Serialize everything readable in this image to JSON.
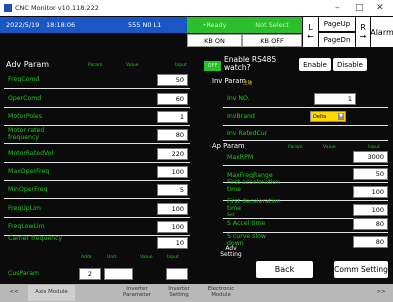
{
  "window": {
    "title": "CNC Monitor v10.118.222",
    "min": "–",
    "max": "□",
    "close": "✕"
  },
  "status": {
    "date": "2022/5/19",
    "time": "18:18:06",
    "machine": "555 N0 L1",
    "ready": "•Ready",
    "not_select": "Not Select",
    "kb_on": "KB ON",
    "kb_off": "KB OFF"
  },
  "nav": {
    "left_letter": "L",
    "left_arrow": "←",
    "page_up": "PageUp",
    "page_dn": "PageDn",
    "right_letter": "R",
    "right_arrow": "→",
    "alarm": "Alarm"
  },
  "adv": {
    "heading": "Adv Param",
    "col_param": "Param",
    "col_value": "Value",
    "col_input": "Input",
    "rows": [
      {
        "label": "FreqComd",
        "input": "50"
      },
      {
        "label": "OperComd",
        "input": "60"
      },
      {
        "label": "MotorPoles",
        "input": "1"
      },
      {
        "label": "Motor rated frequency",
        "input": "80"
      },
      {
        "label": "MotorRatedVol",
        "input": "220"
      },
      {
        "label": "MaxOperFreq",
        "input": "100"
      },
      {
        "label": "MinOperFreq",
        "input": "5"
      },
      {
        "label": "FreqUpLim",
        "input": "100"
      },
      {
        "label": "FreqLowLim",
        "input": "100"
      },
      {
        "label": "Carrier frequency",
        "input": "10"
      }
    ]
  },
  "cus": {
    "col_addr": "Addr",
    "col_unit": "Unit",
    "col_value": "Value",
    "col_input": "Input",
    "label": "CusParam",
    "addr": "2"
  },
  "inv": {
    "off": "OFF",
    "enable_label": "Enable RS485 watch?",
    "enable_btn": "Enable",
    "disable_btn": "Disable",
    "heading": "Inv Param",
    "subheading": "主轴",
    "no_label": "Inv NO.",
    "no_value": "1",
    "brand_label": "InvBrand",
    "brand_value": "Delta",
    "brand_arrow": "▼",
    "rated_cur_label": "Inv RatedCur"
  },
  "ap": {
    "heading": "Ap Param",
    "col_param": "Param",
    "col_value": "Value",
    "col_input": "Input",
    "rows": [
      {
        "label": "MaxRPM",
        "input": "3000"
      },
      {
        "label": "MaxFreqRange",
        "input": "50"
      },
      {
        "label": "First acceleration time",
        "input": "100"
      },
      {
        "label": "First deceleration time",
        "input": "100"
      },
      {
        "label": "S Accel time",
        "note": "Set",
        "input": "80"
      },
      {
        "label": "S curve slow down",
        "input": "80"
      }
    ]
  },
  "actions": {
    "adv_setting": "Adv Setting",
    "back": "Back",
    "comm_setting": "Comm Setting"
  },
  "tabs": {
    "back": "<<",
    "items": [
      "Axis Module",
      "Inverter Parameter",
      "Inverter Setting",
      "Electronic Module"
    ],
    "forward": ">>"
  }
}
